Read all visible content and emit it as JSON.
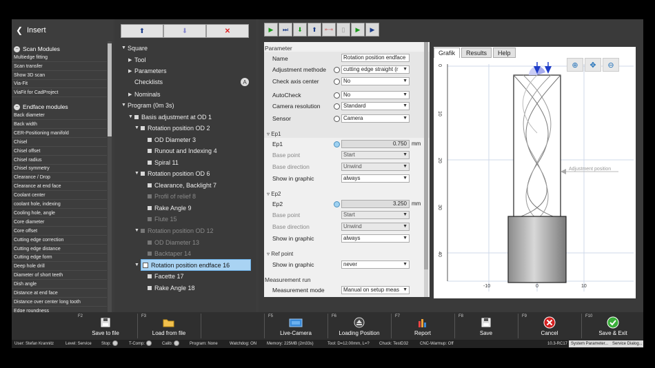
{
  "insert": {
    "title": "Insert"
  },
  "scan_modules": {
    "title": "Scan Modules",
    "items": [
      "Multiedge fitting",
      "Scan transfer",
      "Show 3D scan",
      "Via-Fit",
      "ViaFit for CadProject"
    ]
  },
  "endface_modules": {
    "title": "Endface modules",
    "items": [
      "Back diameter",
      "Back width",
      "CER-Positioning manifold",
      "Chisel",
      "Chisel offset",
      "Chisel radius",
      "Chisel symmetry",
      "Clearance / Drop",
      "Clearance at end face",
      "Coolant center",
      "coolant hole, indexing",
      "Cooling hole, angle",
      "Core diameter",
      "Core offset",
      "Cutting edge correction",
      "Cutting edge distance",
      "Cutting edge form",
      "Deep hole drill",
      "Diameter of short teeth",
      "Dish angle",
      "Distance at end face",
      "Distance over center long tooth",
      "Edge roundness"
    ]
  },
  "tree": {
    "buttons": [
      "up-arrow",
      "down-arrow",
      "delete"
    ],
    "nodes": {
      "square": "Square",
      "tool": "Tool",
      "parameters": "Parameters",
      "checklists": "Checklists",
      "checklists_badge": "A",
      "nominals": "Nominals",
      "program": "Program (0m 3s)",
      "basis": "Basis adjustment at OD 1",
      "rot_od2": "Rotation position OD 2",
      "od_diam3": "OD Diameter 3",
      "runout4": "Runout and Indexing 4",
      "spiral11": "Spiral 11",
      "rot_od6": "Rotation position OD 6",
      "clearance7": "Clearance, Backlight 7",
      "profile8": "Profil of relief 8",
      "rake9": "Rake Angle 9",
      "flute15": "Flute 15",
      "rot_od12": "Rotation position OD 12",
      "od_diam13": "OD Diameter 13",
      "backtaper14": "Backtaper 14",
      "rot_endface16": "Rotation position endface 16",
      "facette17": "Facette 17",
      "rake18": "Rake Angle 18"
    }
  },
  "parameter": {
    "header": "Parameter",
    "name_label": "Name",
    "name_value": "Rotation position endface",
    "adj_label": "Adjustment methode",
    "adj_value": "cutting edge straight (r",
    "check_axis_label": "Check axis center",
    "check_axis_value": "No",
    "autocheck_label": "AutoCheck",
    "autocheck_value": "No",
    "camres_label": "Camera resolution",
    "camres_value": "Standard",
    "sensor_label": "Sensor",
    "sensor_value": "Camera"
  },
  "ep1": {
    "header": "Ep1",
    "label": "Ep1",
    "value": "0.750",
    "unit": "mm",
    "base_point_label": "Base point",
    "base_point_value": "Start",
    "base_dir_label": "Base direction",
    "base_dir_value": "Unwind",
    "show_label": "Show in graphic",
    "show_value": "always"
  },
  "ep2": {
    "header": "Ep2",
    "label": "Ep2",
    "value": "3.250",
    "unit": "mm",
    "base_point_label": "Base point",
    "base_point_value": "Start",
    "base_dir_label": "Base direction",
    "base_dir_value": "Unwind",
    "show_label": "Show in graphic",
    "show_value": "always"
  },
  "refpoint": {
    "header": "Ref point",
    "show_label": "Show in graphic",
    "show_value": "never"
  },
  "measrun": {
    "header": "Measurement run",
    "mode_label": "Measurement mode",
    "mode_value": "Manual on setup meas"
  },
  "graphic": {
    "tabs": [
      "Grafik",
      "Results",
      "Help"
    ],
    "annotation": "Adjustment position",
    "y_ticks": [
      "0",
      "10",
      "20",
      "30",
      "40"
    ],
    "x_ticks": [
      "-10",
      "0",
      "10"
    ]
  },
  "fkeys": [
    {
      "key": "F2",
      "label": "Save to file",
      "icon": "save-icon"
    },
    {
      "key": "F3",
      "label": "Load from file",
      "icon": "folder-icon"
    },
    {
      "key": "F5",
      "label": "Live-Camera",
      "icon": "camera-icon"
    },
    {
      "key": "F6",
      "label": "Loading Position",
      "icon": "eject-icon"
    },
    {
      "key": "F7",
      "label": "Report",
      "icon": "report-icon"
    },
    {
      "key": "F8",
      "label": "Save",
      "icon": "save-icon"
    },
    {
      "key": "F9",
      "label": "Cancel",
      "icon": "cancel-icon"
    },
    {
      "key": "F10",
      "label": "Save & Exit",
      "icon": "check-icon"
    }
  ],
  "status": {
    "user": "User:  Stefan Krannitz",
    "level": "Level:  Service",
    "stop": "Stop:",
    "tcomp": "T-Comp:",
    "calib": "Calib:",
    "program": "Program:  None",
    "watchdog": "Watchdog:  ON",
    "memory": "Memory:  225MB (2m33s)",
    "tool": "Tool:  D=12.00mm, L=?",
    "chuck": "Chuck:  TestD32",
    "cnc": "CNC-Warmup:  Off",
    "version": "10.3-RC17",
    "sys_params": "System Parameter...",
    "service_dialog": "Service Dialog..."
  }
}
